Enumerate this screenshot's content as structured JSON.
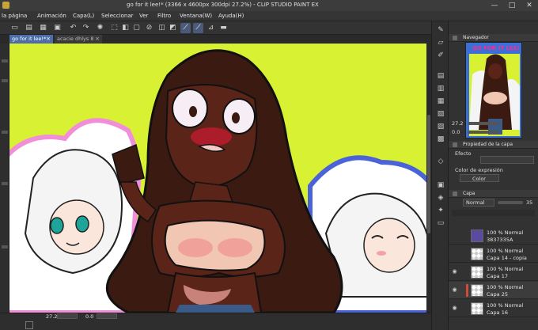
{
  "titlebar": {
    "title": "go for it lee!* (3366 x 4600px 300dpi 27.2%)  -  CLIP STUDIO PAINT EX",
    "minimize": "—",
    "maximize": "□",
    "close": "✕"
  },
  "menu": [
    "la página",
    "Animación",
    "Capa(L)",
    "Seleccionar",
    "Ver",
    "Filtro",
    "Ventana(W)",
    "Ayuda(H)"
  ],
  "tabs": {
    "active": "go for it lee!*",
    "inactive": "acacie dhlys 8",
    "close": "×"
  },
  "status": {
    "zoom": "27.2",
    "angle": "0.0"
  },
  "navigator": {
    "title": "Navegador",
    "zoom": "27.2",
    "angle": "0.0",
    "thumb_title": "GO FOR IT LEE!"
  },
  "properties": {
    "title": "Propiedad de la capa",
    "effect_label": "Efecto",
    "color_expr_label": "Color de expresión",
    "color_value": "Color"
  },
  "layers": {
    "title": "Capa",
    "blend_mode": "Normal",
    "opacity": "35",
    "items": [
      {
        "mode": "100 % Normal",
        "name": "3837335A",
        "visible": false
      },
      {
        "mode": "100 % Normal",
        "name": "Capa 14 - copia",
        "visible": false
      },
      {
        "mode": "100 % Normal",
        "name": "Capa 17",
        "visible": true
      },
      {
        "mode": "100 % Normal",
        "name": "Capa 25",
        "visible": true
      },
      {
        "mode": "100 % Normal",
        "name": "Capa 16",
        "visible": true
      }
    ]
  },
  "colors": {
    "canvas_bg": "#d8f233",
    "accent": "#4d6ea8",
    "skin": "#5a2418",
    "hair": "#3b1a12"
  }
}
